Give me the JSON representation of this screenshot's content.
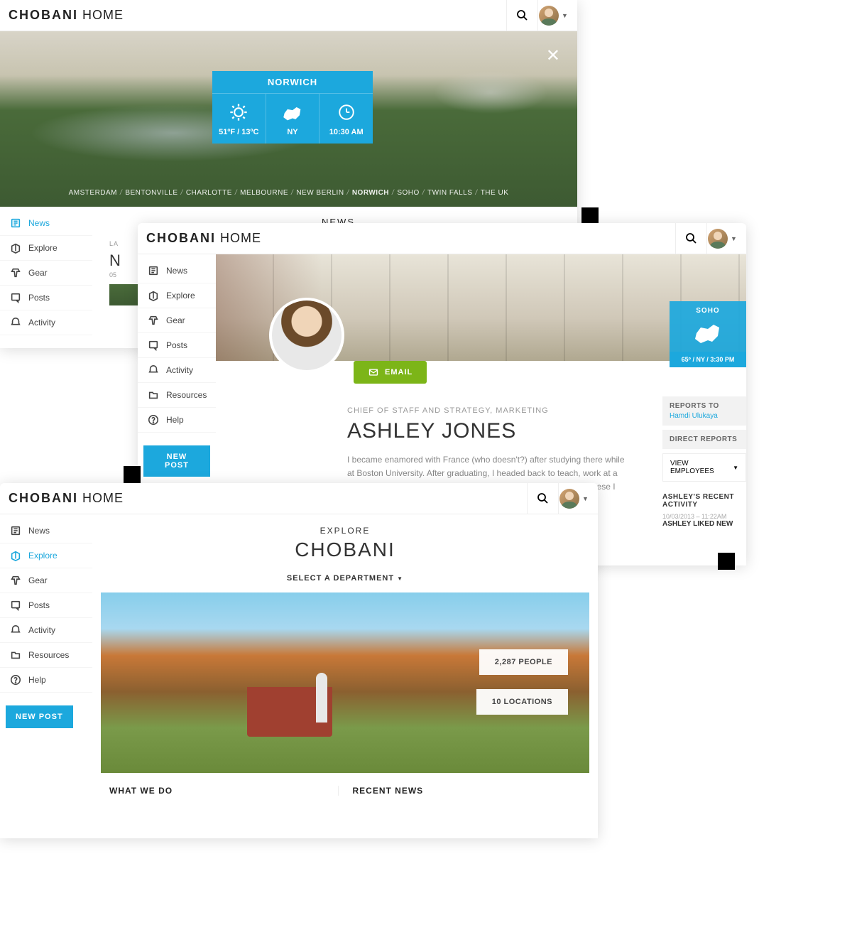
{
  "brand": {
    "bold": "CHOBANI",
    "light": "HOME"
  },
  "nav": {
    "news": "News",
    "explore": "Explore",
    "gear": "Gear",
    "posts": "Posts",
    "activity": "Activity",
    "resources": "Resources",
    "help": "Help",
    "new_post": "NEW POST"
  },
  "frame1": {
    "weather": {
      "city": "NORWICH",
      "temp": "51ºF / 13ºC",
      "state": "NY",
      "time": "10:30 AM"
    },
    "locations": [
      "AMSTERDAM",
      "BENTONVILLE",
      "CHARLOTTE",
      "MELBOURNE",
      "NEW BERLIN",
      "NORWICH",
      "SOHO",
      "TWIN FALLS",
      "THE UK"
    ],
    "section": "NEWS",
    "card": {
      "kicker": "LA",
      "title": "N",
      "date": "05"
    }
  },
  "frame2": {
    "email_btn": "EMAIL",
    "soho": {
      "title": "SOHO",
      "stat": "65º / NY / 3:30 PM"
    },
    "profile": {
      "role": "CHIEF OF STAFF AND STRATEGY, MARKETING",
      "name": "ASHLEY JONES",
      "bio": "I became enamored with France (who doesn't?) after studying there while at Boston University. After graduating, I headed back to teach, work at a B&B, stumble my way through the language and eat whatever cheese I could get my"
    },
    "reports": {
      "label": "REPORTS TO",
      "name": "Hamdi Ulukaya"
    },
    "direct": "DIRECT REPORTS",
    "view_emp": "VIEW EMPLOYEES",
    "activity": {
      "header": "ASHLEY'S RECENT ACTIVITY",
      "ts": "10/03/2013 – 11:22AM",
      "txt": "ASHLEY LIKED NEW"
    }
  },
  "frame3": {
    "section": "EXPLORE",
    "title": "CHOBANI",
    "dept": "SELECT A DEPARTMENT",
    "stat_people": "2,287 PEOPLE",
    "stat_loc": "10 LOCATIONS",
    "what": "WHAT WE DO",
    "recent": "RECENT NEWS"
  }
}
